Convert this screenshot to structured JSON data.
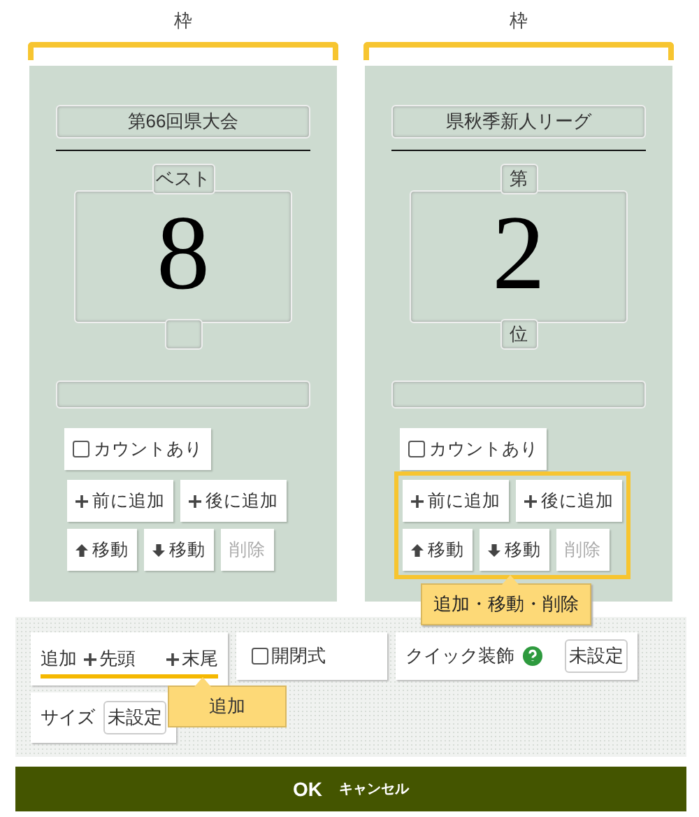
{
  "frames": [
    {
      "heading": "枠",
      "title": "第66回県大会",
      "prefix": "ベスト",
      "number": "8",
      "count": {
        "label": "カウントあり",
        "checked": false
      },
      "highlighted": false,
      "buttons": [
        [
          {
            "kind": "add",
            "label": "前に追加",
            "disabled": false
          },
          {
            "kind": "add",
            "label": "後に追加",
            "disabled": false
          }
        ],
        [
          {
            "kind": "up",
            "label": "移動",
            "disabled": false
          },
          {
            "kind": "down",
            "label": "移動",
            "disabled": false
          },
          {
            "kind": "plain",
            "label": "削除",
            "disabled": true
          }
        ]
      ]
    },
    {
      "heading": "枠",
      "title": "県秋季新人リーグ",
      "prefix": "第",
      "number": "2",
      "suffix": "位",
      "count": {
        "label": "カウントあり",
        "checked": false
      },
      "highlighted": true,
      "callout": "追加・移動・削除",
      "buttons": [
        [
          {
            "kind": "add",
            "label": "前に追加",
            "disabled": false
          },
          {
            "kind": "add",
            "label": "後に追加",
            "disabled": false
          }
        ],
        [
          {
            "kind": "up",
            "label": "移動",
            "disabled": false
          },
          {
            "kind": "down",
            "label": "移動",
            "disabled": false
          },
          {
            "kind": "plain",
            "label": "削除",
            "disabled": true
          }
        ]
      ]
    }
  ],
  "toolbar": {
    "add": {
      "label": "追加",
      "head": "先頭",
      "tail": "末尾",
      "callout": "追加"
    },
    "toggle": {
      "label": "開閉式",
      "checked": false
    },
    "quick": {
      "label": "クイック装飾",
      "value": "未設定"
    },
    "size": {
      "label": "サイズ",
      "value": "未設定"
    }
  },
  "footer": {
    "ok": "OK",
    "cancel": "キャンセル"
  }
}
